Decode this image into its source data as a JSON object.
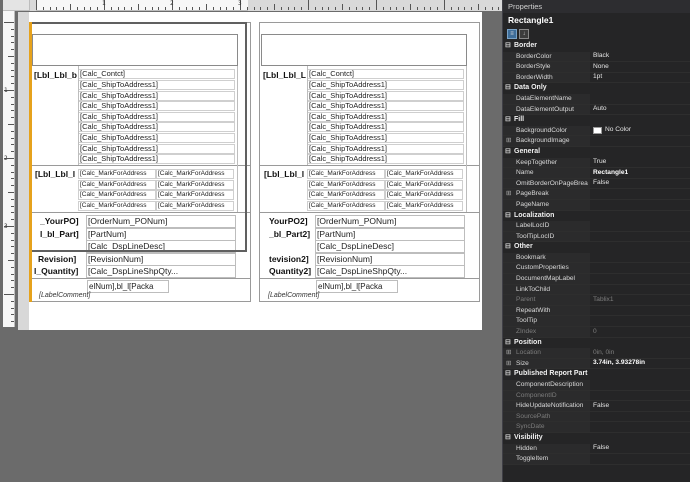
{
  "designer": {
    "ruler_top_numbers": [
      "1",
      "2",
      "3"
    ],
    "ruler_left_numbers": [
      "1",
      "2",
      "3"
    ],
    "left_panel": {
      "header_label": "[Lbl_Lbl_b",
      "contact_field": "[Calc_Contct]",
      "ship_lines": [
        "[Calc_ShipToAddress1]",
        "[Calc_ShipToAddress1]",
        "[Calc_ShipToAddress1]",
        "[Calc_ShipToAddress1]",
        "[Calc_ShipToAddress1]",
        "[Calc_ShipToAddress1]",
        "[Calc_ShipToAddress1]",
        "[Calc_ShipToAddress1]"
      ],
      "mark_label": "[Lbl_Lbl_l",
      "mark_cells": [
        "[Calc_MarkForAddress",
        "[Calc_MarkForAddress",
        "[Calc_MarkForAddress",
        "[Calc_MarkForAddress",
        "[Calc_MarkForAddress",
        "[Calc_MarkForAddress",
        "[Calc_MarkForAddress",
        "[Calc_MarkForAddress"
      ],
      "rows": [
        {
          "label": "_YourPO]",
          "value": "[OrderNum_PONum]"
        },
        {
          "label": "l_bl_Part]",
          "value": "[PartNum]"
        },
        {
          "label": "",
          "value": "[Calc_DspLineDesc]"
        },
        {
          "label": "Revision]",
          "value": "[RevisionNum]"
        },
        {
          "label": "l_Quantity]",
          "value": "[Calc_DspLineShpQty..."
        }
      ],
      "bottom_field": "elNum],bl_l[Packa",
      "comment": "[LabelComment]"
    },
    "right_panel": {
      "header_label": "[Lbl_Lbl_L",
      "contact_field": "[Calc_Contct]",
      "ship_lines": [
        "[Calc_ShipToAddress1]",
        "[Calc_ShipToAddress1]",
        "[Calc_ShipToAddress1]",
        "[Calc_ShipToAddress1]",
        "[Calc_ShipToAddress1]",
        "[Calc_ShipToAddress1]",
        "[Calc_ShipToAddress1]",
        "[Calc_ShipToAddress1]"
      ],
      "mark_label": "[Lbl_Lbl_l",
      "mark_cells": [
        "[Calc_MarkForAddress",
        "[Calc_MarkForAddress",
        "[Calc_MarkForAddress",
        "[Calc_MarkForAddress",
        "[Calc_MarkForAddress",
        "[Calc_MarkForAddress",
        "[Calc_MarkForAddress",
        "[Calc_MarkForAddress"
      ],
      "rows": [
        {
          "label": "YourPO2]",
          "value": "[OrderNum_PONum]"
        },
        {
          "label": "_bl_Part2]",
          "value": "[PartNum]"
        },
        {
          "label": "",
          "value": "[Calc_DspLineDesc]"
        },
        {
          "label": "tevision2]",
          "value": "[RevisionNum]"
        },
        {
          "label": "Quantity2]",
          "value": "[Calc_DspLineShpQty..."
        }
      ],
      "bottom_field": "elNum],bl_l[Packa",
      "comment": "[LabelComment]"
    }
  },
  "properties": {
    "title": "Properties",
    "object_name": "Rectangle1",
    "toolbar": {
      "categorized_icon": "categorized-icon",
      "alphabetical_icon": "alphabetical-icon"
    },
    "categories": [
      {
        "name": "Border",
        "rows": [
          {
            "name": "BorderColor",
            "value": "Black"
          },
          {
            "name": "BorderStyle",
            "value": "None"
          },
          {
            "name": "BorderWidth",
            "value": "1pt"
          }
        ]
      },
      {
        "name": "Data Only",
        "rows": [
          {
            "name": "DataElementName",
            "value": ""
          },
          {
            "name": "DataElementOutput",
            "value": "Auto"
          }
        ]
      },
      {
        "name": "Fill",
        "rows": [
          {
            "name": "BackgroundColor",
            "value": "No Color",
            "swatch": true
          },
          {
            "name": "BackgroundImage",
            "value": "",
            "expandable": true
          }
        ]
      },
      {
        "name": "General",
        "rows": [
          {
            "name": "KeepTogether",
            "value": "True"
          },
          {
            "name": "Name",
            "value": "Rectangle1",
            "bold": true
          },
          {
            "name": "OmitBorderOnPageBrea",
            "value": "False"
          },
          {
            "name": "PageBreak",
            "value": "",
            "expandable": true
          },
          {
            "name": "PageName",
            "value": ""
          }
        ]
      },
      {
        "name": "Localization",
        "rows": [
          {
            "name": "LabelLocID",
            "value": ""
          },
          {
            "name": "ToolTipLocID",
            "value": ""
          }
        ]
      },
      {
        "name": "Other",
        "rows": [
          {
            "name": "Bookmark",
            "value": ""
          },
          {
            "name": "CustomProperties",
            "value": ""
          },
          {
            "name": "DocumentMapLabel",
            "value": ""
          },
          {
            "name": "LinkToChild",
            "value": ""
          },
          {
            "name": "Parent",
            "value": "Tablix1",
            "dim": true
          },
          {
            "name": "RepeatWith",
            "value": ""
          },
          {
            "name": "ToolTip",
            "value": ""
          },
          {
            "name": "ZIndex",
            "value": "0",
            "dim": true
          }
        ]
      },
      {
        "name": "Position",
        "rows": [
          {
            "name": "Location",
            "value": "0in, 0in",
            "dim": true,
            "expandable": true
          },
          {
            "name": "Size",
            "value": "3.74in, 3.93278in",
            "bold": true,
            "expandable": true
          }
        ]
      },
      {
        "name": "Published Report Part",
        "rows": [
          {
            "name": "ComponentDescription",
            "value": ""
          },
          {
            "name": "ComponentID",
            "value": "",
            "dim": true
          },
          {
            "name": "HideUpdateNotification",
            "value": "False"
          },
          {
            "name": "SourcePath",
            "value": "",
            "dim": true
          },
          {
            "name": "SyncDate",
            "value": "",
            "dim": true
          }
        ]
      },
      {
        "name": "Visibility",
        "rows": [
          {
            "name": "Hidden",
            "value": "False"
          },
          {
            "name": "ToggleItem",
            "value": ""
          }
        ]
      }
    ]
  },
  "colors": {
    "selection_accent": "#e6a21c",
    "panel_bg": "#252526",
    "canvas_bg": "#6b6b6b"
  }
}
